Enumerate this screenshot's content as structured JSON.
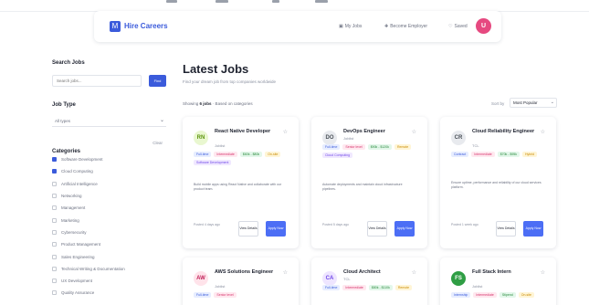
{
  "header": {
    "logo_glyph": "M",
    "logo_text": "Hire Careers",
    "nav": [
      {
        "label": "My Jobs",
        "icon": "briefcase-icon"
      },
      {
        "label": "Become Employer",
        "icon": "building-icon"
      },
      {
        "label": "Saved",
        "icon": "heart-icon"
      }
    ],
    "avatar": "U"
  },
  "sidebar": {
    "search_label": "Search Jobs",
    "search_placeholder": "Search jobs...",
    "search_button": "Find",
    "job_type_label": "Job Type",
    "job_type_value": "All types",
    "categories_label": "Categories",
    "clear_label": "Clear",
    "categories": [
      {
        "label": "Software Development",
        "checked": true
      },
      {
        "label": "Cloud Computing",
        "checked": true
      },
      {
        "label": "Artificial Intelligence",
        "checked": false
      },
      {
        "label": "Networking",
        "checked": false
      },
      {
        "label": "Management",
        "checked": false
      },
      {
        "label": "Marketing",
        "checked": false
      },
      {
        "label": "Cybersecurity",
        "checked": false
      },
      {
        "label": "Product Management",
        "checked": false
      },
      {
        "label": "Sales Engineering",
        "checked": false
      },
      {
        "label": "Technical Writing & Documentation",
        "checked": false
      },
      {
        "label": "UX Development",
        "checked": false
      },
      {
        "label": "Quality Assurance",
        "checked": false
      }
    ]
  },
  "main": {
    "title": "Latest Jobs",
    "subtitle": "Find your dream job from top companies worldwide",
    "showing_prefix": "Showing",
    "showing_count": "6 jobs",
    "showing_suffix": "· Based on categories",
    "sort_label": "Sort by",
    "sort_value": "Most Popular"
  },
  "jobs": [
    {
      "logo": "RN",
      "logo_bg": "#e9f7d0",
      "logo_fg": "#5c940d",
      "title": "React Native Developer",
      "company": "Joblist",
      "tags": [
        [
          "Full-time",
          "blue"
        ],
        [
          "Intermediate",
          "pink"
        ],
        [
          "$60k - $80k",
          "green"
        ],
        [
          "On-site",
          "yellow"
        ],
        [
          "Software Development",
          "purple"
        ]
      ],
      "desc": "Build mobile apps using React Native and collaborate with our product team.",
      "posted": "Posted 4 days ago",
      "details": "View Details",
      "apply": "Apply Now"
    },
    {
      "logo": "DO",
      "logo_bg": "#e8eaee",
      "logo_fg": "#495057",
      "title": "DevOps Engineer",
      "company": "Joblist",
      "tags": [
        [
          "Full-time",
          "blue"
        ],
        [
          "Senior level",
          "pink"
        ],
        [
          "$90k - $120k",
          "green"
        ],
        [
          "Remote",
          "yellow"
        ],
        [
          "Cloud Computing",
          "purple"
        ]
      ],
      "desc": "Automate deployments and maintain cloud infrastructure pipelines.",
      "posted": "Posted 5 days ago",
      "details": "View Details",
      "apply": "Apply Now"
    },
    {
      "logo": "CR",
      "logo_bg": "#e8eaee",
      "logo_fg": "#495057",
      "title": "Cloud Reliability Engineer",
      "company": "TCL",
      "tags": [
        [
          "Contract",
          "blue"
        ],
        [
          "Intermediate",
          "pink"
        ],
        [
          "$70k - $95k",
          "green"
        ],
        [
          "Hybrid",
          "yellow"
        ]
      ],
      "desc": "Ensure uptime, performance and reliability of our cloud services platform.",
      "posted": "Posted 1 week ago",
      "details": "View Details",
      "apply": "Apply Now"
    },
    {
      "logo": "AW",
      "logo_bg": "#ffe3ea",
      "logo_fg": "#c2255c",
      "title": "AWS Solutions Engineer",
      "company": "Joblist",
      "tags": [
        [
          "Full-time",
          "blue"
        ],
        [
          "Senior level",
          "pink"
        ]
      ],
      "desc": "",
      "posted": "",
      "details": "",
      "apply": ""
    },
    {
      "logo": "CA",
      "logo_bg": "#eee5ff",
      "logo_fg": "#7048e8",
      "title": "Cloud Architect",
      "company": "TCL",
      "tags": [
        [
          "Full-time",
          "blue"
        ],
        [
          "Intermediate",
          "pink"
        ],
        [
          "$80k - $110k",
          "green"
        ],
        [
          "Remote",
          "yellow"
        ]
      ],
      "desc": "",
      "posted": "",
      "details": "",
      "apply": ""
    },
    {
      "logo": "FS",
      "logo_bg": "#2f9e44",
      "logo_fg": "#ffffff",
      "title": "Full Stack Intern",
      "company": "Joblist",
      "tags": [
        [
          "Internship",
          "blue"
        ],
        [
          "Intermediate",
          "pink"
        ],
        [
          "Stipend",
          "green"
        ],
        [
          "On-site",
          "yellow"
        ]
      ],
      "desc": "",
      "posted": "",
      "details": "",
      "apply": ""
    }
  ]
}
